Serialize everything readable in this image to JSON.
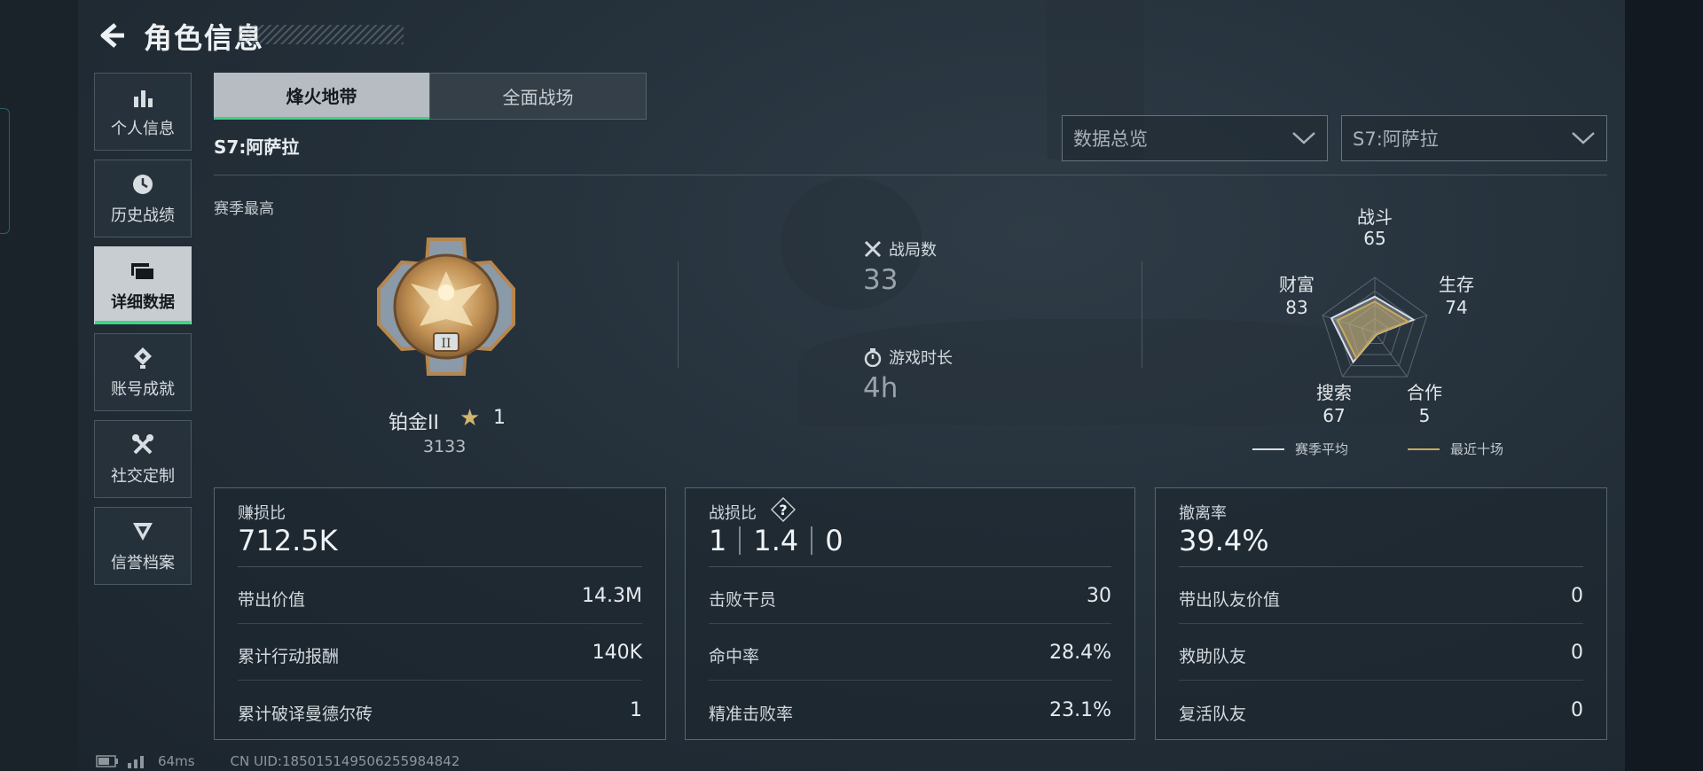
{
  "header": {
    "title": "角色信息"
  },
  "sidebar": {
    "items": [
      {
        "label": "个人信息"
      },
      {
        "label": "历史战绩"
      },
      {
        "label": "详细数据"
      },
      {
        "label": "账号成就"
      },
      {
        "label": "社交定制"
      },
      {
        "label": "信誉档案"
      }
    ]
  },
  "tabs": [
    {
      "label": "烽火地带"
    },
    {
      "label": "全面战场"
    }
  ],
  "season_title": "S7:阿萨拉",
  "filters": {
    "data_view": "数据总览",
    "season": "S7:阿萨拉"
  },
  "season_best": {
    "label": "赛季最高",
    "rank_name": "铂金II",
    "stars": "1",
    "score": "3133"
  },
  "summary": {
    "matches_label": "战局数",
    "matches_value": "33",
    "playtime_label": "游戏时长",
    "playtime_value": "4h"
  },
  "radar": {
    "axes": [
      {
        "label": "战斗",
        "value": "65"
      },
      {
        "label": "生存",
        "value": "74"
      },
      {
        "label": "合作",
        "value": "5"
      },
      {
        "label": "搜索",
        "value": "67"
      },
      {
        "label": "财富",
        "value": "83"
      }
    ],
    "legend": [
      {
        "label": "赛季平均",
        "color": "#d9dee2"
      },
      {
        "label": "最近十场",
        "color": "#c9a95c"
      }
    ]
  },
  "cards": {
    "profit": {
      "title": "赚损比",
      "big": "712.5K",
      "rows": [
        {
          "label": "带出价值",
          "value": "14.3M"
        },
        {
          "label": "累计行动报酬",
          "value": "140K"
        },
        {
          "label": "累计破译曼德尔砖",
          "value": "1"
        }
      ]
    },
    "combat": {
      "title": "战损比",
      "help": "?",
      "kd": [
        "1",
        "1.4",
        "0"
      ],
      "rows": [
        {
          "label": "击败干员",
          "value": "30"
        },
        {
          "label": "命中率",
          "value": "28.4%"
        },
        {
          "label": "精准击败率",
          "value": "23.1%"
        }
      ]
    },
    "extract": {
      "title": "撤离率",
      "big": "39.4%",
      "rows": [
        {
          "label": "带出队友价值",
          "value": "0"
        },
        {
          "label": "救助队友",
          "value": "0"
        },
        {
          "label": "复活队友",
          "value": "0"
        }
      ]
    }
  },
  "footer": {
    "ping": "64ms",
    "uid": "CN UID:1850151495062559848​42"
  },
  "colors": {
    "accent_green": "#3fd67f",
    "gold": "#c9a95c"
  }
}
